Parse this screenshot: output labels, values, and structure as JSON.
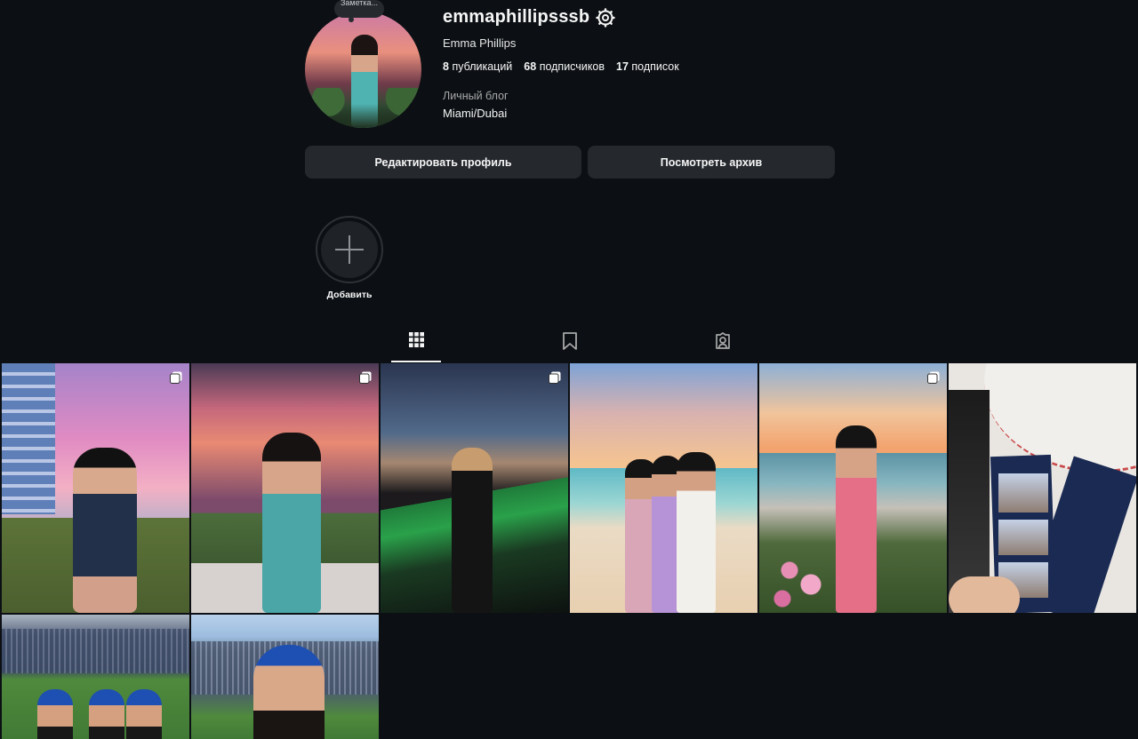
{
  "profile": {
    "note_bubble": "Заметка...",
    "username": "emmaphillipsssb",
    "full_name": "Emma Phillips",
    "stats": {
      "posts_count": "8",
      "posts_label": "публикаций",
      "followers_count": "68",
      "followers_label": "подписчиков",
      "following_count": "17",
      "following_label": "подписок"
    },
    "category": "Личный блог",
    "bio": "Miami/Dubai"
  },
  "buttons": {
    "edit_profile": "Редактировать профиль",
    "view_archive": "Посмотреть архив"
  },
  "highlights": {
    "new_label": "Добавить"
  },
  "tabs": [
    {
      "icon": "grid-icon",
      "active": true
    },
    {
      "icon": "bookmark-icon",
      "active": false
    },
    {
      "icon": "tagged-icon",
      "active": false
    }
  ],
  "posts": [
    {
      "icon": "carousel-icon",
      "multi": true
    },
    {
      "icon": "carousel-icon",
      "multi": true
    },
    {
      "icon": "carousel-icon",
      "multi": true
    },
    {
      "icon": "",
      "multi": false
    },
    {
      "icon": "carousel-icon",
      "multi": true
    },
    {
      "icon": "",
      "multi": false
    },
    {
      "icon": "",
      "multi": false
    },
    {
      "icon": "",
      "multi": false
    }
  ],
  "colors": {
    "background": "#0c1014",
    "button_bg": "#25292e",
    "text_primary": "#f5f5f5",
    "text_secondary": "#a8a8a8"
  }
}
